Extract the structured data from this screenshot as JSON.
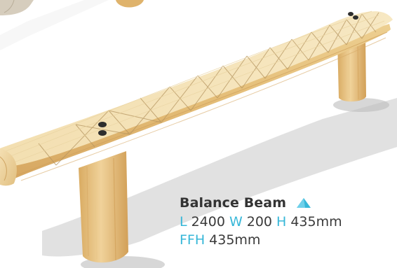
{
  "product": {
    "name": "Balance Beam",
    "icon": "triangle-icon",
    "icon_color": "#37b7d8"
  },
  "dimensions": {
    "length_label": "L",
    "length_value": "2400",
    "width_label": "W",
    "width_value": "200",
    "height_label": "H",
    "height_value": "435mm",
    "ffh_label": "FFH",
    "ffh_value": "435mm"
  },
  "colors": {
    "label_accent": "#37b7d8",
    "text": "#333333",
    "wood_light": "#f3dfae",
    "wood_mid": "#e2c07e",
    "wood_dark": "#c99a55"
  }
}
